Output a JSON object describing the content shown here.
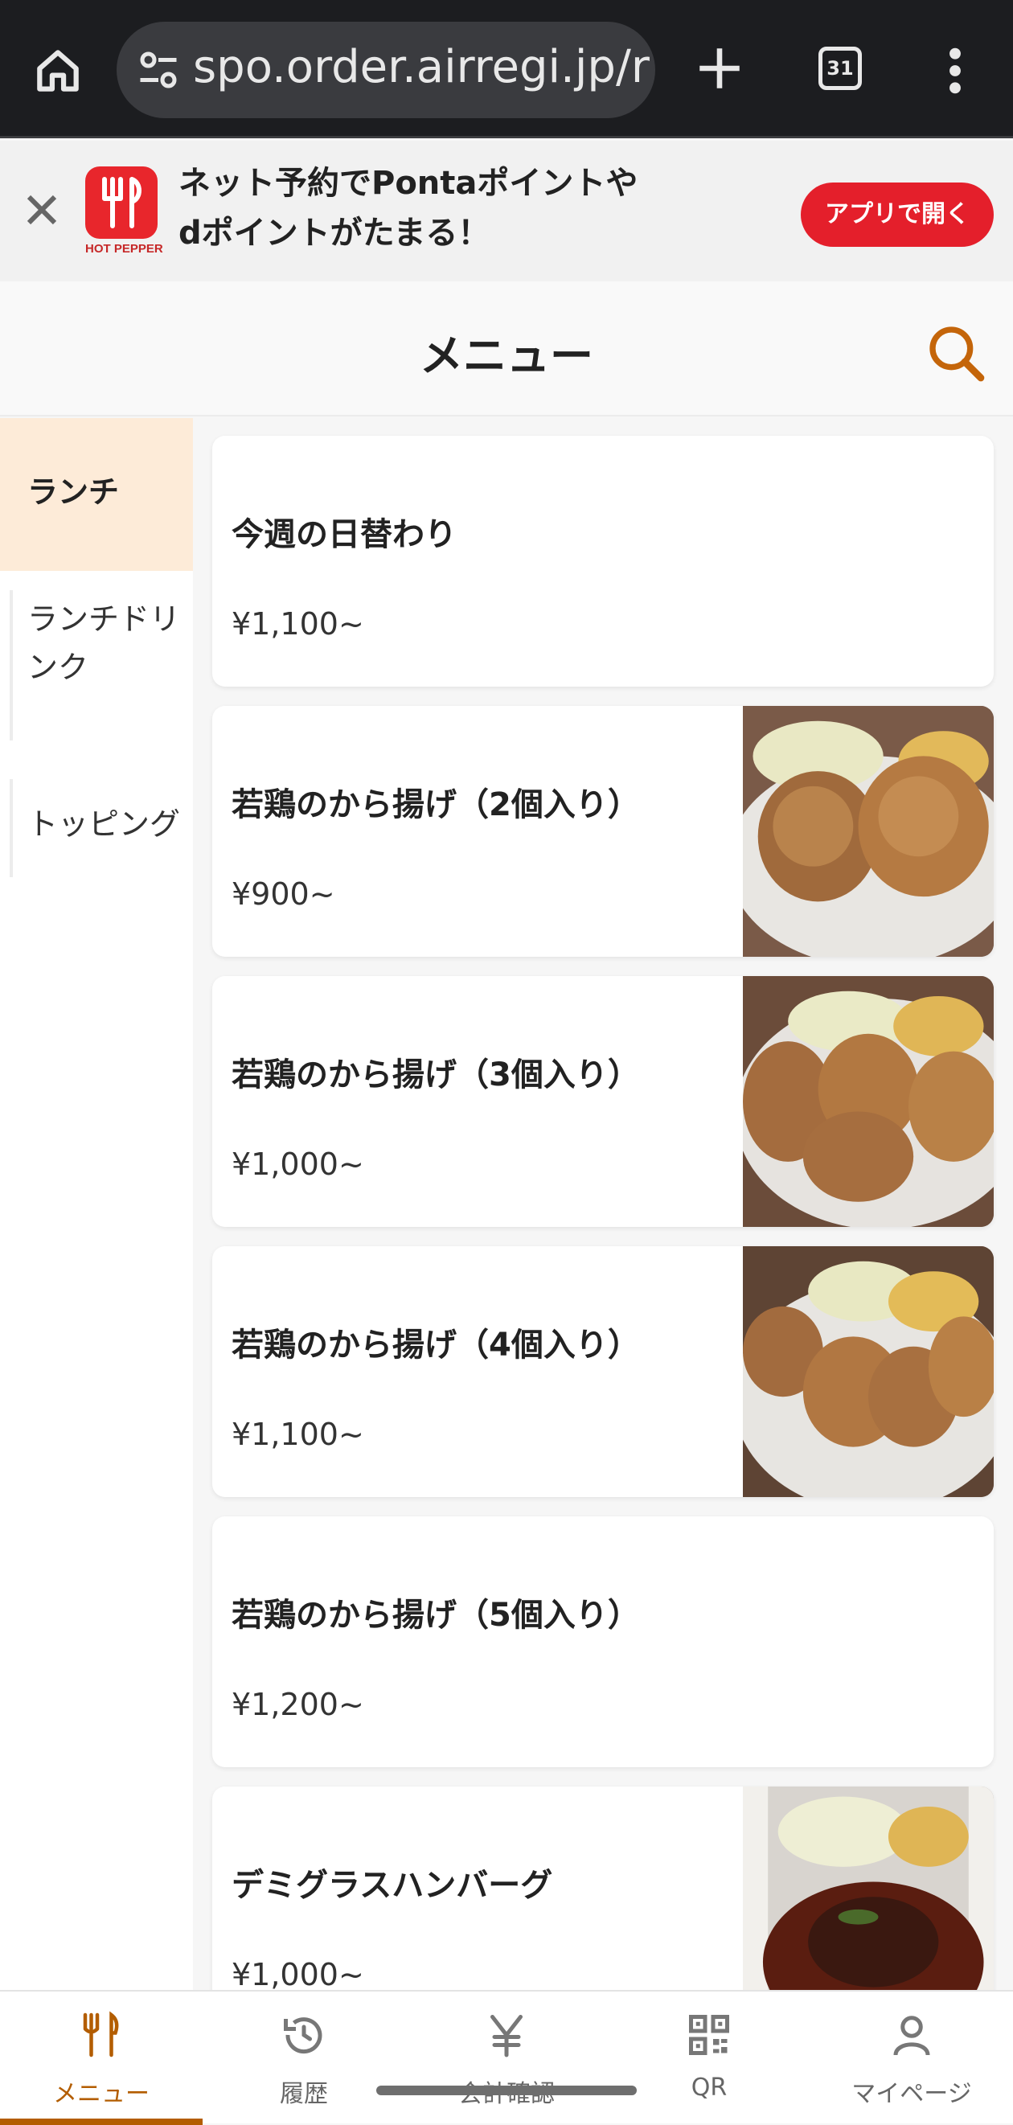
{
  "browser": {
    "url": "spo.order.airregi.jp/r",
    "tab_count": "31",
    "icons": [
      "home-icon",
      "site-settings-icon",
      "new-tab-icon",
      "tabs-icon",
      "more-icon"
    ]
  },
  "banner": {
    "logo_caption": "HOT PEPPER",
    "message_line1": "ネット予約でPontaポイントや",
    "message_line2": "dポイントがたまる！",
    "open_button": "アプリで開く",
    "brand_color": "#e41f2b"
  },
  "header": {
    "title": "メニュー"
  },
  "categories": [
    {
      "label": "ランチ",
      "active": true
    },
    {
      "label": "ランチドリンク",
      "active": false
    },
    {
      "label": "トッピング",
      "active": false
    }
  ],
  "items": [
    {
      "name": "今週の日替わり",
      "price": "¥1,100~",
      "has_photo": false
    },
    {
      "name": "若鶏のから揚げ（2個入り）",
      "price": "¥900~",
      "has_photo": true
    },
    {
      "name": "若鶏のから揚げ（3個入り）",
      "price": "¥1,000~",
      "has_photo": true
    },
    {
      "name": "若鶏のから揚げ（4個入り）",
      "price": "¥1,100~",
      "has_photo": true
    },
    {
      "name": "若鶏のから揚げ（5個入り）",
      "price": "¥1,200~",
      "has_photo": false
    },
    {
      "name": "デミグラスハンバーグ",
      "price": "¥1,000~",
      "has_photo": true
    }
  ],
  "nav": {
    "menu": "メニュー",
    "history": "履歴",
    "checkout": "会計確認",
    "qr": "QR",
    "mypage": "マイページ",
    "accent_color": "#b35d00"
  }
}
